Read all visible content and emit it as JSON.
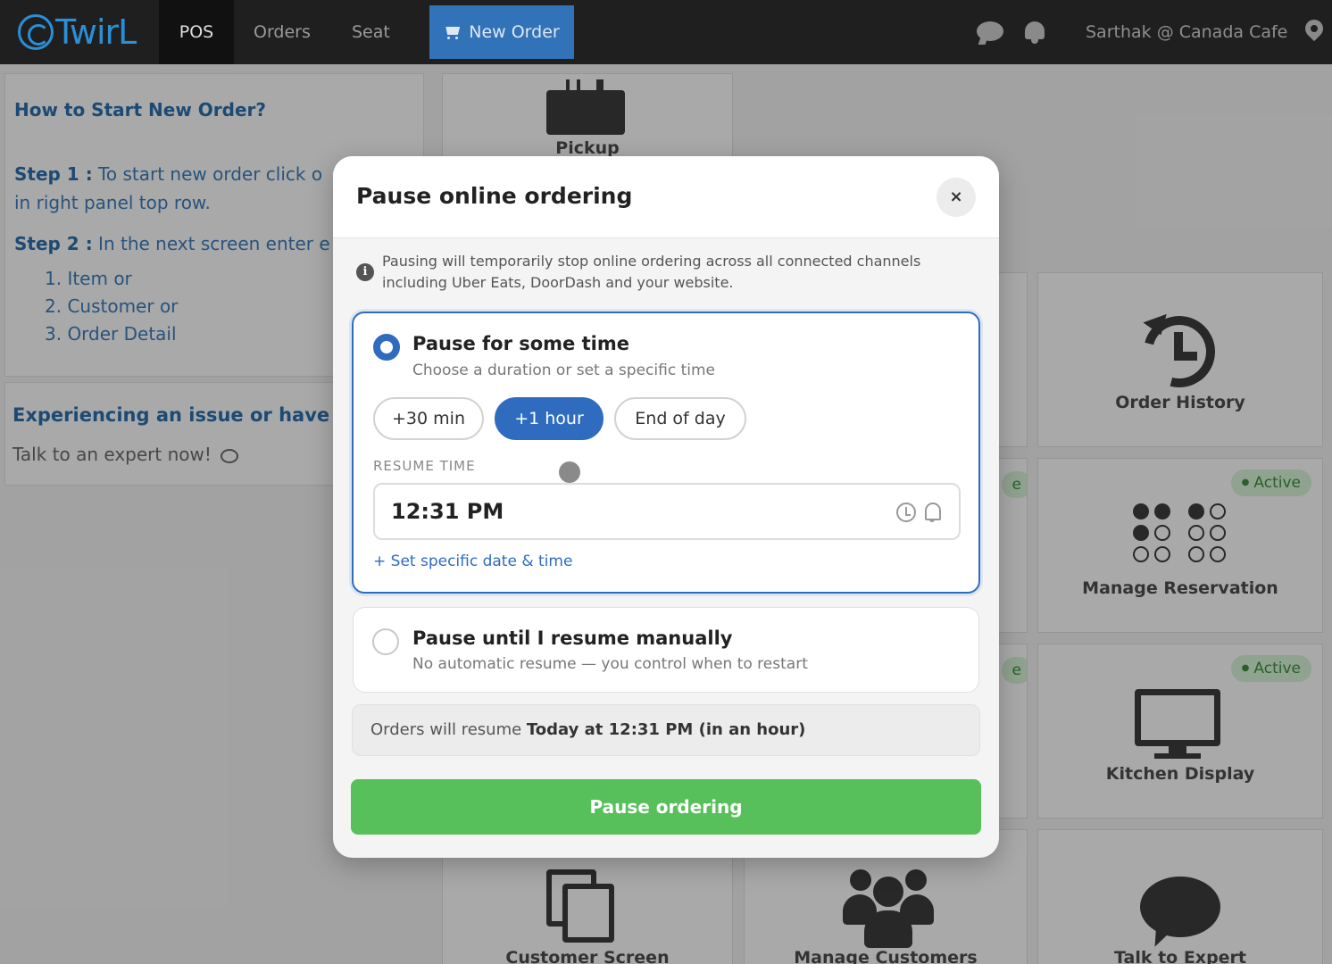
{
  "nav": {
    "logo": "TwirL",
    "pos": "POS",
    "orders": "Orders",
    "seat": "Seat",
    "new_order": "New Order",
    "user": "Sarthak @ Canada Cafe"
  },
  "help": {
    "title": "How to Start New Order?",
    "step1_label": "Step 1 :",
    "step1_text": "To start new order click o",
    "step1_text2": "in right panel top row.",
    "step2_label": "Step 2 :",
    "step2_text": "In the next screen enter e",
    "items": [
      "1. Item or",
      "2. Customer or",
      "3. Order Detail"
    ],
    "issue_title": "Experiencing an issue or have a q",
    "issue_sub": "Talk to an expert now!"
  },
  "tiles": {
    "pickup": "Pickup",
    "order_history": "Order History",
    "manage_reservation": "Manage Reservation",
    "kitchen_display": "Kitchen Display",
    "customer_screen": "Customer Screen",
    "manage_customers": "Manage Customers",
    "talk_to_expert": "Talk to Expert",
    "active_badge": "Active",
    "active_badge_peek": "e"
  },
  "modal": {
    "title": "Pause online ordering",
    "close": "×",
    "info": "Pausing will temporarily stop online ordering across all connected channels including Uber Eats, DoorDash and your website.",
    "option1": {
      "title": "Pause for some time",
      "subtitle": "Choose a duration or set a specific time",
      "durations": [
        "+30 min",
        "+1 hour",
        "End of day"
      ],
      "selected_duration": "+1 hour",
      "resume_label": "RESUME TIME",
      "resume_time": "12:31 PM",
      "set_specific": "+ Set specific date & time"
    },
    "option2": {
      "title": "Pause until I resume manually",
      "subtitle": "No automatic resume — you control when to restart"
    },
    "summary_prefix": "Orders will resume",
    "summary_value": "Today at 12:31 PM (in an hour)",
    "pause_button": "Pause ordering"
  },
  "colors": {
    "primary": "#2f6cc0",
    "success": "#57c05a",
    "nav_bg": "#1f1f1f",
    "link": "#2a6aa6"
  }
}
